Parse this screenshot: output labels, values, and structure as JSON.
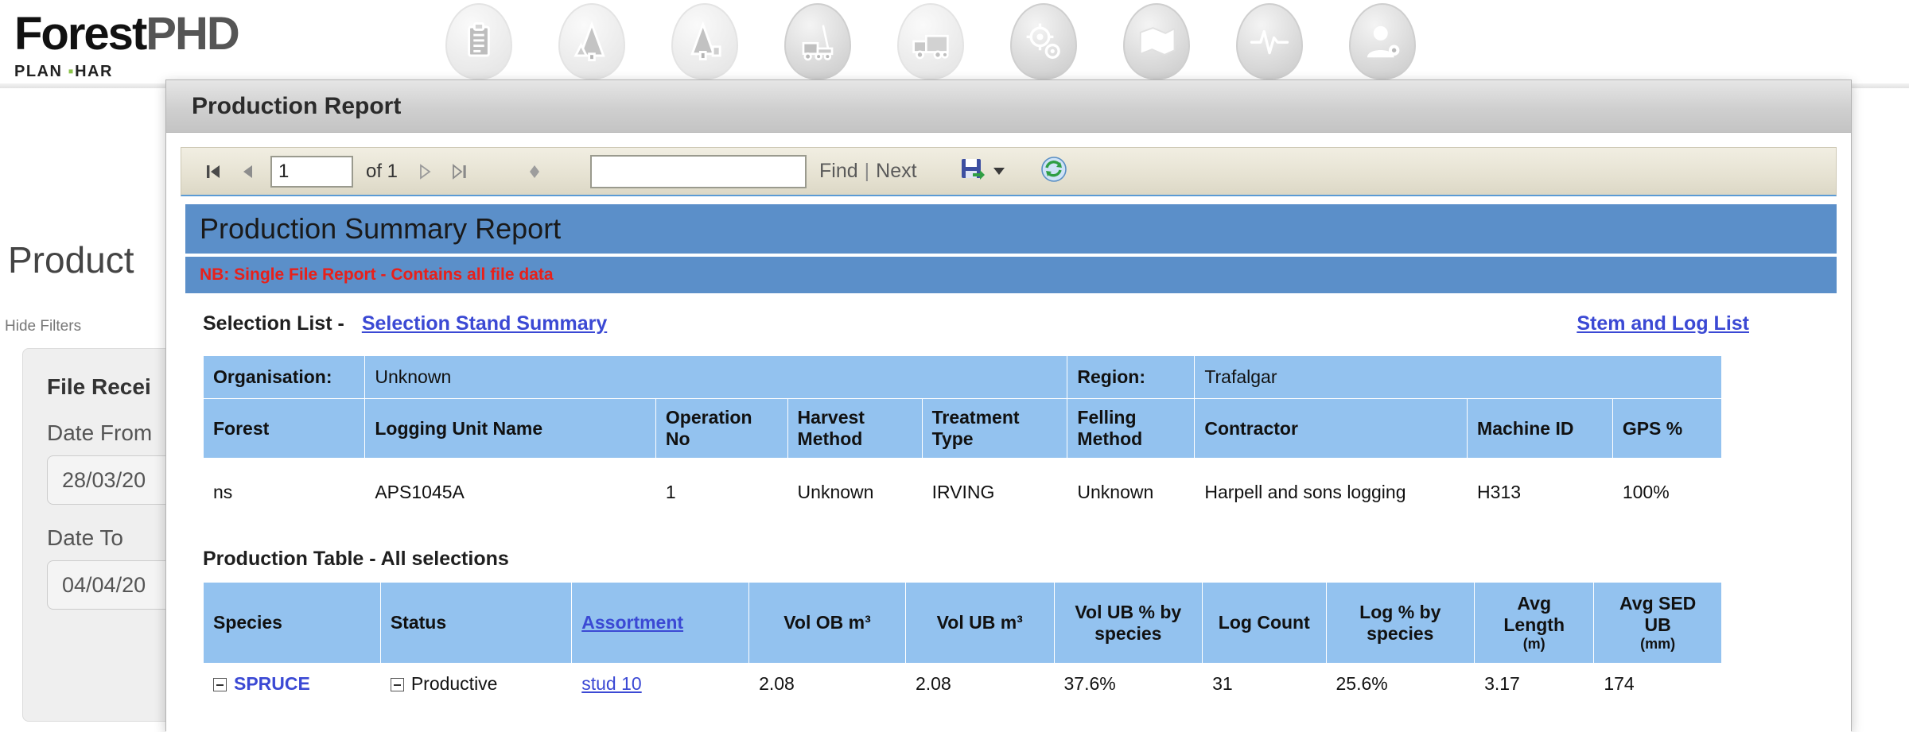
{
  "brand": {
    "name_part1": "Forest",
    "name_part2": "PHD",
    "tagline_pre": "PLAN ",
    "tagline_dot": "▪",
    "tagline_post": "HAR"
  },
  "nav_icons": [
    {
      "name": "clipboard-report-icon"
    },
    {
      "name": "forest-plan-icon"
    },
    {
      "name": "tree-harvest-icon"
    },
    {
      "name": "harvester-machine-icon"
    },
    {
      "name": "truck-haulage-icon"
    },
    {
      "name": "settings-gear-icon"
    },
    {
      "name": "map-folder-icon"
    },
    {
      "name": "analytics-pulse-icon"
    },
    {
      "name": "user-admin-icon"
    }
  ],
  "background_page": {
    "title": "Product",
    "hide_filters": "Hide Filters",
    "filters": {
      "group_title": "File Recei",
      "date_from_label": "Date From",
      "date_from_value": "28/03/20",
      "date_to_label": "Date To",
      "date_to_value": "04/04/20"
    }
  },
  "modal": {
    "title": "Production Report"
  },
  "toolbar": {
    "first_page_icon": "first-page-icon",
    "prev_page_icon": "previous-page-icon",
    "page_number": "1",
    "of_label": "of 1",
    "next_page_icon": "next-page-icon",
    "last_page_icon": "last-page-icon",
    "back_icon": "back-to-parent-icon",
    "find_value": "",
    "find_placeholder": "",
    "find_label": "Find",
    "find_separator": "|",
    "next_label": "Next",
    "export_icon": "export-save-icon",
    "refresh_icon": "refresh-icon"
  },
  "report": {
    "banner_title": "Production Summary Report",
    "note": "NB: Single File Report - Contains all file data",
    "selection_list_label": "Selection List -",
    "selection_stand_summary_link": "Selection Stand Summary",
    "stem_and_log_list_link": "Stem and Log List",
    "info_table": {
      "meta_row": [
        {
          "label": "Organisation:",
          "value": "Unknown"
        },
        {
          "label": "Region:",
          "value": "Trafalgar"
        }
      ],
      "headers": [
        "Forest",
        "Logging Unit Name",
        "Operation No",
        "Harvest Method",
        "Treatment Type",
        "Felling Method",
        "Contractor",
        "Machine ID",
        "GPS %"
      ],
      "rows": [
        [
          "ns",
          "APS1045A",
          "1",
          "Unknown",
          "IRVING",
          "Unknown",
          "Harpell and sons logging",
          "H313",
          "100%"
        ]
      ]
    },
    "production_table": {
      "title": "Production Table - All selections",
      "headers": [
        {
          "main": "Species",
          "sub": "",
          "link": false
        },
        {
          "main": "Status",
          "sub": "",
          "link": false
        },
        {
          "main": "Assortment",
          "sub": "",
          "link": true
        },
        {
          "main": "Vol OB m³",
          "sub": "",
          "link": false
        },
        {
          "main": "Vol UB m³",
          "sub": "",
          "link": false
        },
        {
          "main": "Vol UB % by species",
          "sub": "",
          "link": false
        },
        {
          "main": "Log Count",
          "sub": "",
          "link": false
        },
        {
          "main": "Log % by species",
          "sub": "",
          "link": false
        },
        {
          "main": "Avg Length",
          "sub": "(m)",
          "link": false
        },
        {
          "main": "Avg SED UB",
          "sub": "(mm)",
          "link": false
        }
      ],
      "rows": [
        {
          "species": "SPRUCE",
          "status": "Productive",
          "assortment": "stud 10",
          "vol_ob": "2.08",
          "vol_ub": "2.08",
          "vol_ub_pct": "37.6%",
          "log_count": "31",
          "log_pct": "25.6%",
          "avg_length": "3.17",
          "avg_sed_ub": "174"
        }
      ]
    }
  },
  "colors": {
    "banner_blue": "#5b8fc9",
    "table_header_blue": "#93c2ef",
    "link_blue": "#3b49d4",
    "note_red": "#e8201a",
    "toolbar_beige": "#e6e2d2"
  }
}
